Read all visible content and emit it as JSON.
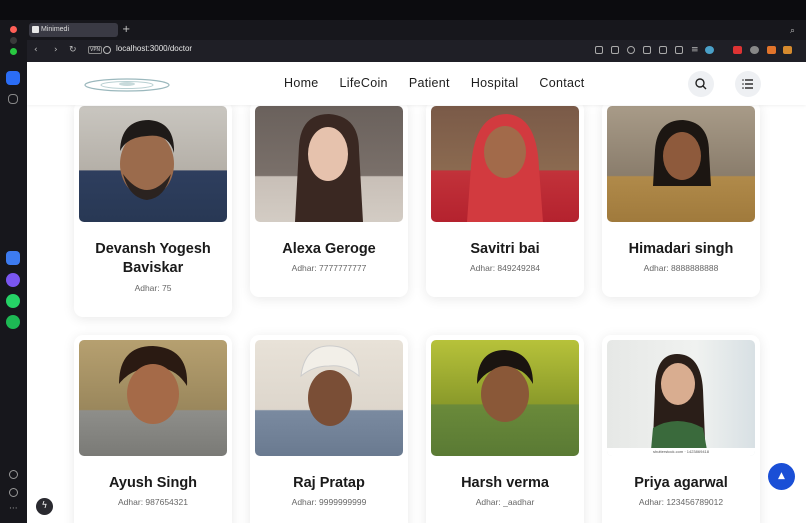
{
  "browser": {
    "tab_title": "Minimedi",
    "new_tab": "+",
    "url": "localhost:3000/doctor",
    "vpn_label": "VPN"
  },
  "site": {
    "nav": [
      "Home",
      "LifeCoin",
      "Patient",
      "Hospital",
      "Contact"
    ]
  },
  "doctors": [
    {
      "name": "Devansh Yogesh Baviskar",
      "adhar": "Adhar: 75"
    },
    {
      "name": "Alexa Geroge",
      "adhar": "Adhar: 7777777777"
    },
    {
      "name": "Savitri bai",
      "adhar": "Adhar: 849249284"
    },
    {
      "name": "Himadari singh",
      "adhar": "Adhar: 8888888888"
    },
    {
      "name": "Ayush Singh",
      "adhar": "Adhar: 987654321"
    },
    {
      "name": "Raj Pratap",
      "adhar": "Adhar: 9999999999"
    },
    {
      "name": "Harsh verma",
      "adhar": "Adhar: _aadhar"
    },
    {
      "name": "Priya agarwal",
      "adhar": "Adhar: 123456789012"
    }
  ],
  "photo_caption": "shutterstock.com · 1423869418",
  "colors": {
    "accent": "#1a4fd6",
    "chrome": "#17171c"
  }
}
